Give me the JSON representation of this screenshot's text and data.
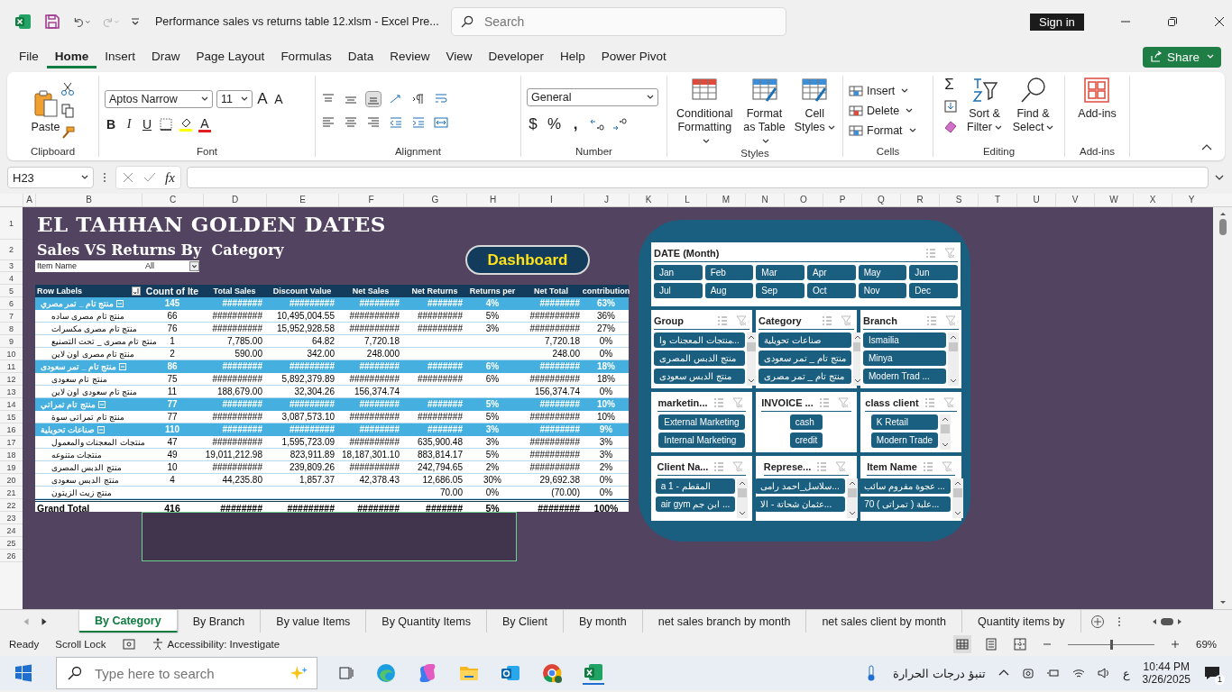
{
  "window": {
    "title": "Performance sales vs returns  table 12.xlsm  -  Excel Pre...",
    "search_placeholder": "Search",
    "sign_in": "Sign in"
  },
  "menu": {
    "tabs": [
      {
        "label": "File",
        "selected": false
      },
      {
        "label": "Home",
        "selected": true
      },
      {
        "label": "Insert",
        "selected": false
      },
      {
        "label": "Draw",
        "selected": false
      },
      {
        "label": "Page Layout",
        "selected": false
      },
      {
        "label": "Formulas",
        "selected": false
      },
      {
        "label": "Data",
        "selected": false
      },
      {
        "label": "Review",
        "selected": false
      },
      {
        "label": "View",
        "selected": false
      },
      {
        "label": "Developer",
        "selected": false
      },
      {
        "label": "Help",
        "selected": false
      },
      {
        "label": "Power Pivot",
        "selected": false
      }
    ],
    "share": "Share"
  },
  "ribbon": {
    "clipboard": {
      "label": "Clipboard",
      "paste": "Paste"
    },
    "font": {
      "label": "Font",
      "name": "Aptos Narrow",
      "size": "11",
      "grow": "A",
      "shrink": "A",
      "bold": "B",
      "italic": "I",
      "underline": "U",
      "text_color_glyph": "A"
    },
    "alignment": {
      "label": "Alignment"
    },
    "number": {
      "label": "Number",
      "format": "General",
      "currency": "$",
      "percent": "%",
      "comma": ","
    },
    "styles": {
      "label": "Styles",
      "buttons": [
        "Conditional Formatting",
        "Format as Table",
        "Cell Styles"
      ]
    },
    "cells": {
      "label": "Cells",
      "buttons": [
        "Insert",
        "Delete",
        "Format"
      ]
    },
    "editing": {
      "label": "Editing",
      "sum": "Σ",
      "buttons": [
        "Sort & Filter",
        "Find & Select"
      ]
    },
    "addins": {
      "label": "Add-ins",
      "button": "Add-ins"
    }
  },
  "formula_bar": {
    "name_box": "H23",
    "fx": "fx"
  },
  "sheet": {
    "columns": [
      "A",
      "B",
      "C",
      "D",
      "E",
      "F",
      "G",
      "H",
      "I",
      "J",
      "K",
      "L",
      "M",
      "N",
      "O",
      "P",
      "Q",
      "R",
      "S",
      "T",
      "U",
      "V",
      "W",
      "X",
      "Y"
    ],
    "rows": [
      "1",
      "2",
      "3",
      "4",
      "5",
      "6",
      "7",
      "8",
      "9",
      "10",
      "11",
      "12",
      "13",
      "14",
      "15",
      "16",
      "17",
      "18",
      "19",
      "20",
      "21",
      "22",
      "23",
      "24",
      "25",
      "26"
    ],
    "title": "EL TAHHAN GOLDEN DATES",
    "subtitle": "Sales VS Returns By  Category",
    "dashboard_button": "Dashboard"
  },
  "pivot": {
    "filter": {
      "label": "Item Name",
      "value": "All"
    },
    "columns": [
      "Row Labels",
      "Count of Ite",
      "Total Sales",
      "Discount Value",
      "Net Sales",
      "Net Returns",
      "Returns per",
      "Net Total",
      "contribution"
    ],
    "rows": [
      {
        "kind": "group",
        "expanded": true,
        "cells": [
          "منتج تام _ تمر مصري",
          "145",
          "########",
          "#########",
          "########",
          "#######",
          "4%",
          "########",
          "63%"
        ]
      },
      {
        "kind": "item",
        "cells": [
          "منتج تام مصرى ساده",
          "66",
          "##########",
          "10,495,004.55",
          "##########",
          "#########",
          "5%",
          "##########",
          "36%"
        ]
      },
      {
        "kind": "item",
        "cells": [
          "منتج تام مصرى مكسرات",
          "76",
          "##########",
          "15,952,928.58",
          "##########",
          "#########",
          "3%",
          "##########",
          "27%"
        ]
      },
      {
        "kind": "item",
        "cells": [
          "منتج تام مصرى _ تحت التصنيع",
          "1",
          "7,785.00",
          "64.82",
          "7,720.18",
          null,
          null,
          "7,720.18",
          "0%"
        ]
      },
      {
        "kind": "item",
        "cells": [
          "منتج تام مصرى اون لاين",
          "2",
          "590.00",
          "342.00",
          "248.000",
          null,
          null,
          "248.00",
          "0%"
        ]
      },
      {
        "kind": "group",
        "expanded": true,
        "cells": [
          "منتج تام _ تمر سعودى",
          "86",
          "########",
          "#########",
          "########",
          "#######",
          "6%",
          "########",
          "18%"
        ]
      },
      {
        "kind": "item",
        "cells": [
          "منتج تام سعودى",
          "75",
          "##########",
          "5,892,379.89",
          "##########",
          "#########",
          "6%",
          "##########",
          "18%"
        ]
      },
      {
        "kind": "item",
        "cells": [
          "منتج تام سعودى اون لاين",
          "11",
          "188,679.00",
          "32,304.26",
          "156,374.74",
          null,
          null,
          "156,374.74",
          "0%"
        ]
      },
      {
        "kind": "group",
        "expanded": true,
        "cells": [
          "منتج تام تمراتي",
          "77",
          "########",
          "#########",
          "########",
          "#######",
          "5%",
          "########",
          "10%"
        ]
      },
      {
        "kind": "item",
        "cells": [
          "منتج تام تمراتى سوة",
          "77",
          "##########",
          "3,087,573.10",
          "##########",
          "#########",
          "5%",
          "##########",
          "10%"
        ]
      },
      {
        "kind": "group",
        "expanded": true,
        "cells": [
          "صناعات تحويلية",
          "110",
          "########",
          "#########",
          "########",
          "#######",
          "3%",
          "########",
          "9%"
        ]
      },
      {
        "kind": "item",
        "cells": [
          "منتجات المعجنات والمعمول",
          "47",
          "##########",
          "1,595,723.09",
          "##########",
          "635,900.48",
          "3%",
          "##########",
          "3%"
        ]
      },
      {
        "kind": "item",
        "cells": [
          "منتجات متنوعه",
          "49",
          "19,011,212.98",
          "823,911.89",
          "18,187,301.10",
          "883,814.17",
          "5%",
          "##########",
          "3%"
        ]
      },
      {
        "kind": "item",
        "cells": [
          "منتج الدبس المصرى",
          "10",
          "##########",
          "239,809.26",
          "##########",
          "242,794.65",
          "2%",
          "##########",
          "2%"
        ]
      },
      {
        "kind": "item",
        "cells": [
          "منتج الدبس سعودى",
          "4",
          "44,235.80",
          "1,857.37",
          "42,378.43",
          "12,686.05",
          "30%",
          "29,692.38",
          "0%"
        ]
      },
      {
        "kind": "item",
        "cells": [
          "منتج زيت الزيتون",
          null,
          null,
          null,
          null,
          "70.00",
          "0%",
          "(70.00)",
          "0%"
        ]
      },
      {
        "kind": "total",
        "cells": [
          "Grand Total",
          "416",
          "########",
          "#########",
          "########",
          "#######",
          "5%",
          "########",
          "100%"
        ]
      }
    ]
  },
  "slicers": {
    "date": {
      "title": "DATE (Month)",
      "items": [
        "Jan",
        "Feb",
        "Mar",
        "Apr",
        "May",
        "Jun",
        "Jul",
        "Aug",
        "Sep",
        "Oct",
        "Nov",
        "Dec"
      ]
    },
    "panels": [
      {
        "title": "Group",
        "scrollbar": true,
        "items": [
          "منتجات المعجنات وا...",
          "منتج الدبس المصرى",
          "منتج الدبس سعودى"
        ]
      },
      {
        "title": "Category",
        "scrollbar": true,
        "items": [
          "صناعات تحويلية",
          "منتج تام _ تمر سعودى",
          "منتج تام _ تمر مصرى"
        ]
      },
      {
        "title": "Branch",
        "scrollbar": true,
        "items": [
          "Ismailia",
          "Minya",
          "Modern Trad ..."
        ]
      },
      {
        "title": "marketin...",
        "scrollbar": false,
        "items": [
          "External Marketing",
          "Internal Marketing"
        ]
      },
      {
        "title": "INVOICE ...",
        "scrollbar": false,
        "items": [
          "cash",
          "credit"
        ]
      },
      {
        "title": "class client",
        "scrollbar": true,
        "items": [
          "K Retail",
          "Modern Trade"
        ]
      },
      {
        "title": "Client Na...",
        "scrollbar": true,
        "items": [
          "a 1 - المقطم",
          "air gym ابن جم ..."
        ]
      },
      {
        "title": "Represe...",
        "scrollbar": true,
        "items": [
          "سلاسل_احمد رامى...",
          "عثمان شحاتة - الا..."
        ]
      },
      {
        "title": "Item Name",
        "scrollbar": true,
        "items": [
          "عجوة مفروم سائب ...",
          "70 علبة ( تمراتى )..."
        ]
      }
    ]
  },
  "sheet_tabs": [
    {
      "label": "By Category",
      "selected": true
    },
    {
      "label": "By Branch",
      "selected": false
    },
    {
      "label": "By value Items",
      "selected": false
    },
    {
      "label": "By Quantity Items",
      "selected": false
    },
    {
      "label": "By Client",
      "selected": false
    },
    {
      "label": "By month",
      "selected": false
    },
    {
      "label": "net sales branch by month",
      "selected": false
    },
    {
      "label": "net sales client by month",
      "selected": false
    },
    {
      "label": "Quantity items by",
      "selected": false
    }
  ],
  "status_bar": {
    "mode": "Ready",
    "scroll_lock": "Scroll Lock",
    "accessibility": "Accessibility: Investigate",
    "zoom": {
      "level": 0.5,
      "reading": "69%"
    }
  },
  "taskbar": {
    "search_placeholder": "Type here to search",
    "weather": "تنبؤ درجات الحرارة",
    "language": "ع",
    "time": "10:44 PM",
    "date": "3/26/2025",
    "notifications": "1"
  }
}
